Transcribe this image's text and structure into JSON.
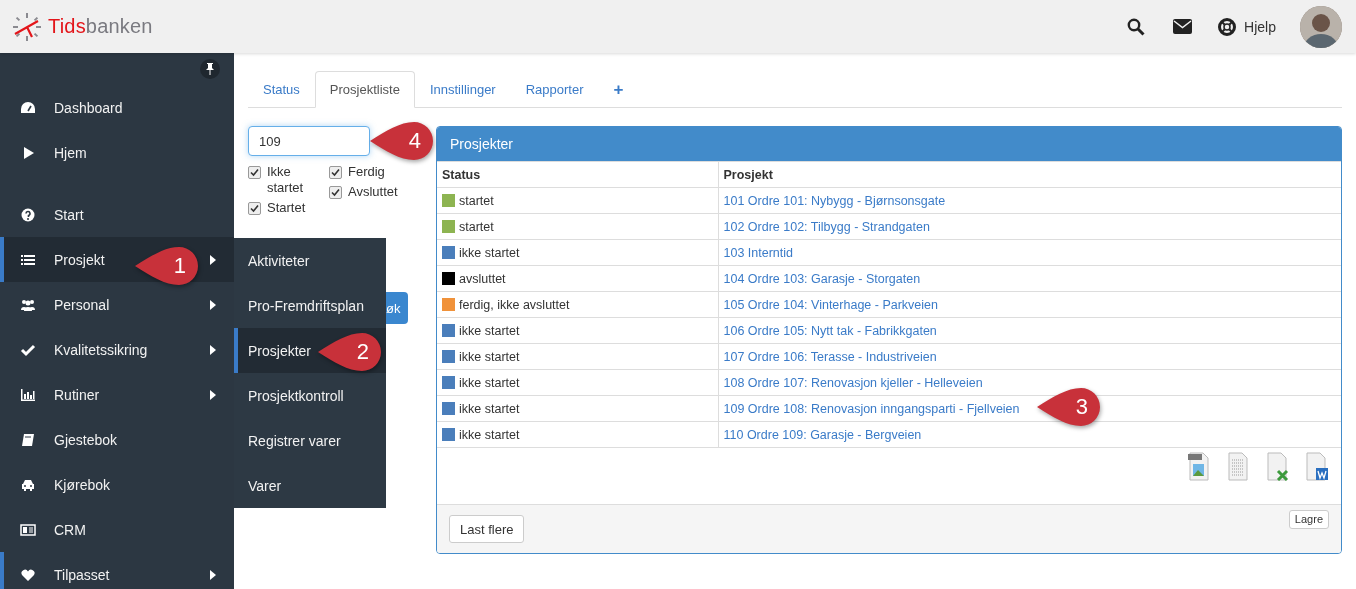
{
  "header": {
    "logo": {
      "prefix": "Tids",
      "suffix": "banken"
    },
    "help_label": "Hjelp"
  },
  "sidebar": {
    "sections": [
      {
        "items": [
          {
            "label": "Dashboard",
            "submenu": false,
            "selected": false,
            "accent": false
          },
          {
            "label": "Hjem",
            "submenu": false,
            "selected": false,
            "accent": false
          }
        ]
      },
      {
        "items": [
          {
            "label": "Start",
            "submenu": false,
            "selected": false,
            "accent": false
          },
          {
            "label": "Prosjekt",
            "submenu": true,
            "selected": true,
            "accent": true
          },
          {
            "label": "Personal",
            "submenu": true,
            "selected": false,
            "accent": false
          },
          {
            "label": "Kvalitetssikring",
            "submenu": true,
            "selected": false,
            "accent": false
          },
          {
            "label": "Rutiner",
            "submenu": true,
            "selected": false,
            "accent": false
          },
          {
            "label": "Gjestebok",
            "submenu": false,
            "selected": false,
            "accent": false
          },
          {
            "label": "Kjørebok",
            "submenu": false,
            "selected": false,
            "accent": false
          },
          {
            "label": "CRM",
            "submenu": false,
            "selected": false,
            "accent": false
          },
          {
            "label": "Tilpasset",
            "submenu": true,
            "selected": false,
            "accent": true
          }
        ]
      }
    ]
  },
  "submenu": {
    "items": [
      {
        "label": "Aktiviteter",
        "selected": false
      },
      {
        "label": "Pro-Fremdriftsplan",
        "selected": false
      },
      {
        "label": "Prosjekter",
        "selected": true
      },
      {
        "label": "Prosjektkontroll",
        "selected": false
      },
      {
        "label": "Registrer varer",
        "selected": false
      },
      {
        "label": "Varer",
        "selected": false
      }
    ]
  },
  "tabs": [
    {
      "label": "Status",
      "selected": false
    },
    {
      "label": "Prosjektliste",
      "selected": true
    },
    {
      "label": "Innstillinger",
      "selected": false
    },
    {
      "label": "Rapporter",
      "selected": false
    },
    {
      "label": "+",
      "selected": false
    }
  ],
  "filter": {
    "search_value": "109",
    "checkboxes": [
      [
        {
          "label": "Ikke startet",
          "checked": true
        },
        {
          "label": "Startet",
          "checked": true
        }
      ],
      [
        {
          "label": "Ferdig",
          "checked": true
        },
        {
          "label": "Avsluttet",
          "checked": true
        }
      ]
    ],
    "search_button": "øk"
  },
  "panel": {
    "title": "Prosjekter",
    "columns": [
      "Status",
      "Prosjekt"
    ],
    "rows": [
      {
        "status": "startet",
        "color": "#8db451",
        "project": "101 Ordre 101: Nybygg - Bjørnsonsgate"
      },
      {
        "status": "startet",
        "color": "#8db451",
        "project": "102 Ordre 102: Tilbygg - Strandgaten"
      },
      {
        "status": "ikke startet",
        "color": "#4a7ebb",
        "project": "103 Interntid"
      },
      {
        "status": "avsluttet",
        "color": "#000000",
        "project": "104 Ordre 103: Garasje - Storgaten"
      },
      {
        "status": "ferdig, ikke avsluttet",
        "color": "#f0923a",
        "project": "105 Ordre 104: Vinterhage - Parkveien"
      },
      {
        "status": "ikke startet",
        "color": "#4a7ebb",
        "project": "106 Ordre 105: Nytt tak - Fabrikkgaten"
      },
      {
        "status": "ikke startet",
        "color": "#4a7ebb",
        "project": "107 Ordre 106: Terasse - Industriveien"
      },
      {
        "status": "ikke startet",
        "color": "#4a7ebb",
        "project": "108 Ordre 107: Renovasjon kjeller - Helleveien"
      },
      {
        "status": "ikke startet",
        "color": "#4a7ebb",
        "project": "109 Ordre 108: Renovasjon inngangsparti - Fjellveien"
      },
      {
        "status": "ikke startet",
        "color": "#4a7ebb",
        "project": "110 Ordre 109: Garasje - Bergveien"
      }
    ],
    "load_more": "Last flere",
    "save": "Lagre"
  },
  "callouts": [
    {
      "label": "1"
    },
    {
      "label": "2"
    },
    {
      "label": "3"
    },
    {
      "label": "4"
    }
  ]
}
